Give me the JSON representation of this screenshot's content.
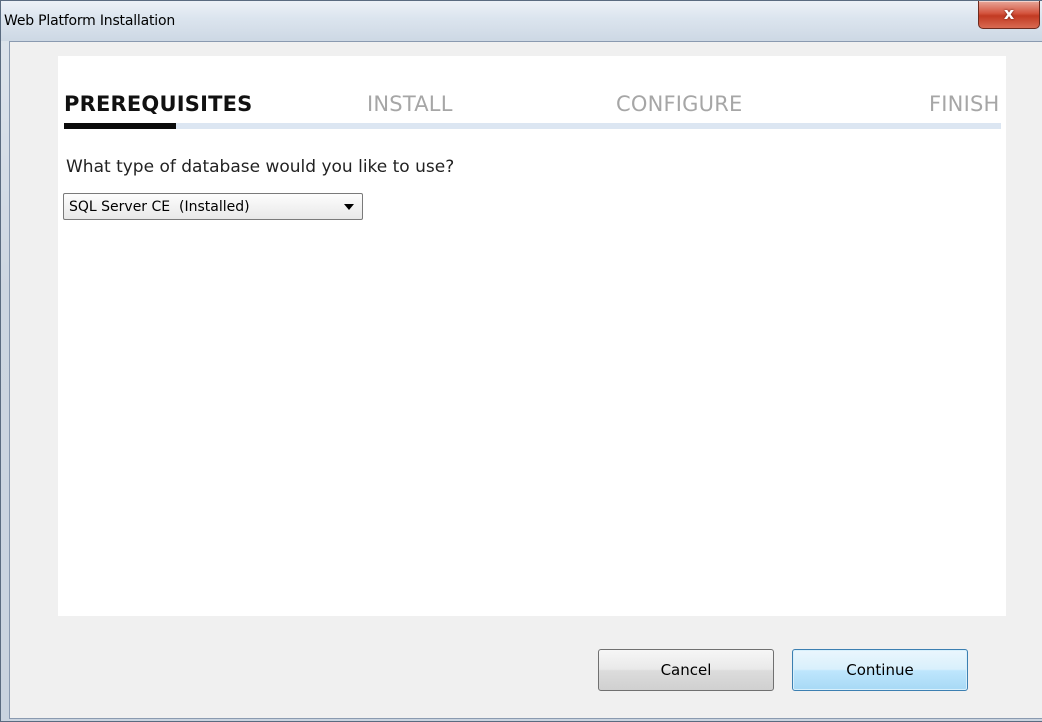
{
  "window": {
    "title": "Web Platform Installation",
    "close_icon": "close-icon",
    "close_glyph": "x"
  },
  "wizard": {
    "steps": [
      {
        "label": "PREREQUISITES",
        "active": true
      },
      {
        "label": "INSTALL",
        "active": false
      },
      {
        "label": "CONFIGURE",
        "active": false
      },
      {
        "label": "FINISH",
        "active": false
      }
    ],
    "progress_fraction": 0.12
  },
  "form": {
    "question": "What type of database would you like to use?",
    "database_select": {
      "selected": "SQL Server CE  (Installed)",
      "icon": "chevron-down-icon"
    }
  },
  "buttons": {
    "cancel_label": "Cancel",
    "continue_label": "Continue"
  },
  "colors": {
    "progress_fill": "#0b0b0b",
    "progress_track": "#dce6f2",
    "close_button": "#c23a22",
    "default_button_border": "#3c7fb1"
  }
}
